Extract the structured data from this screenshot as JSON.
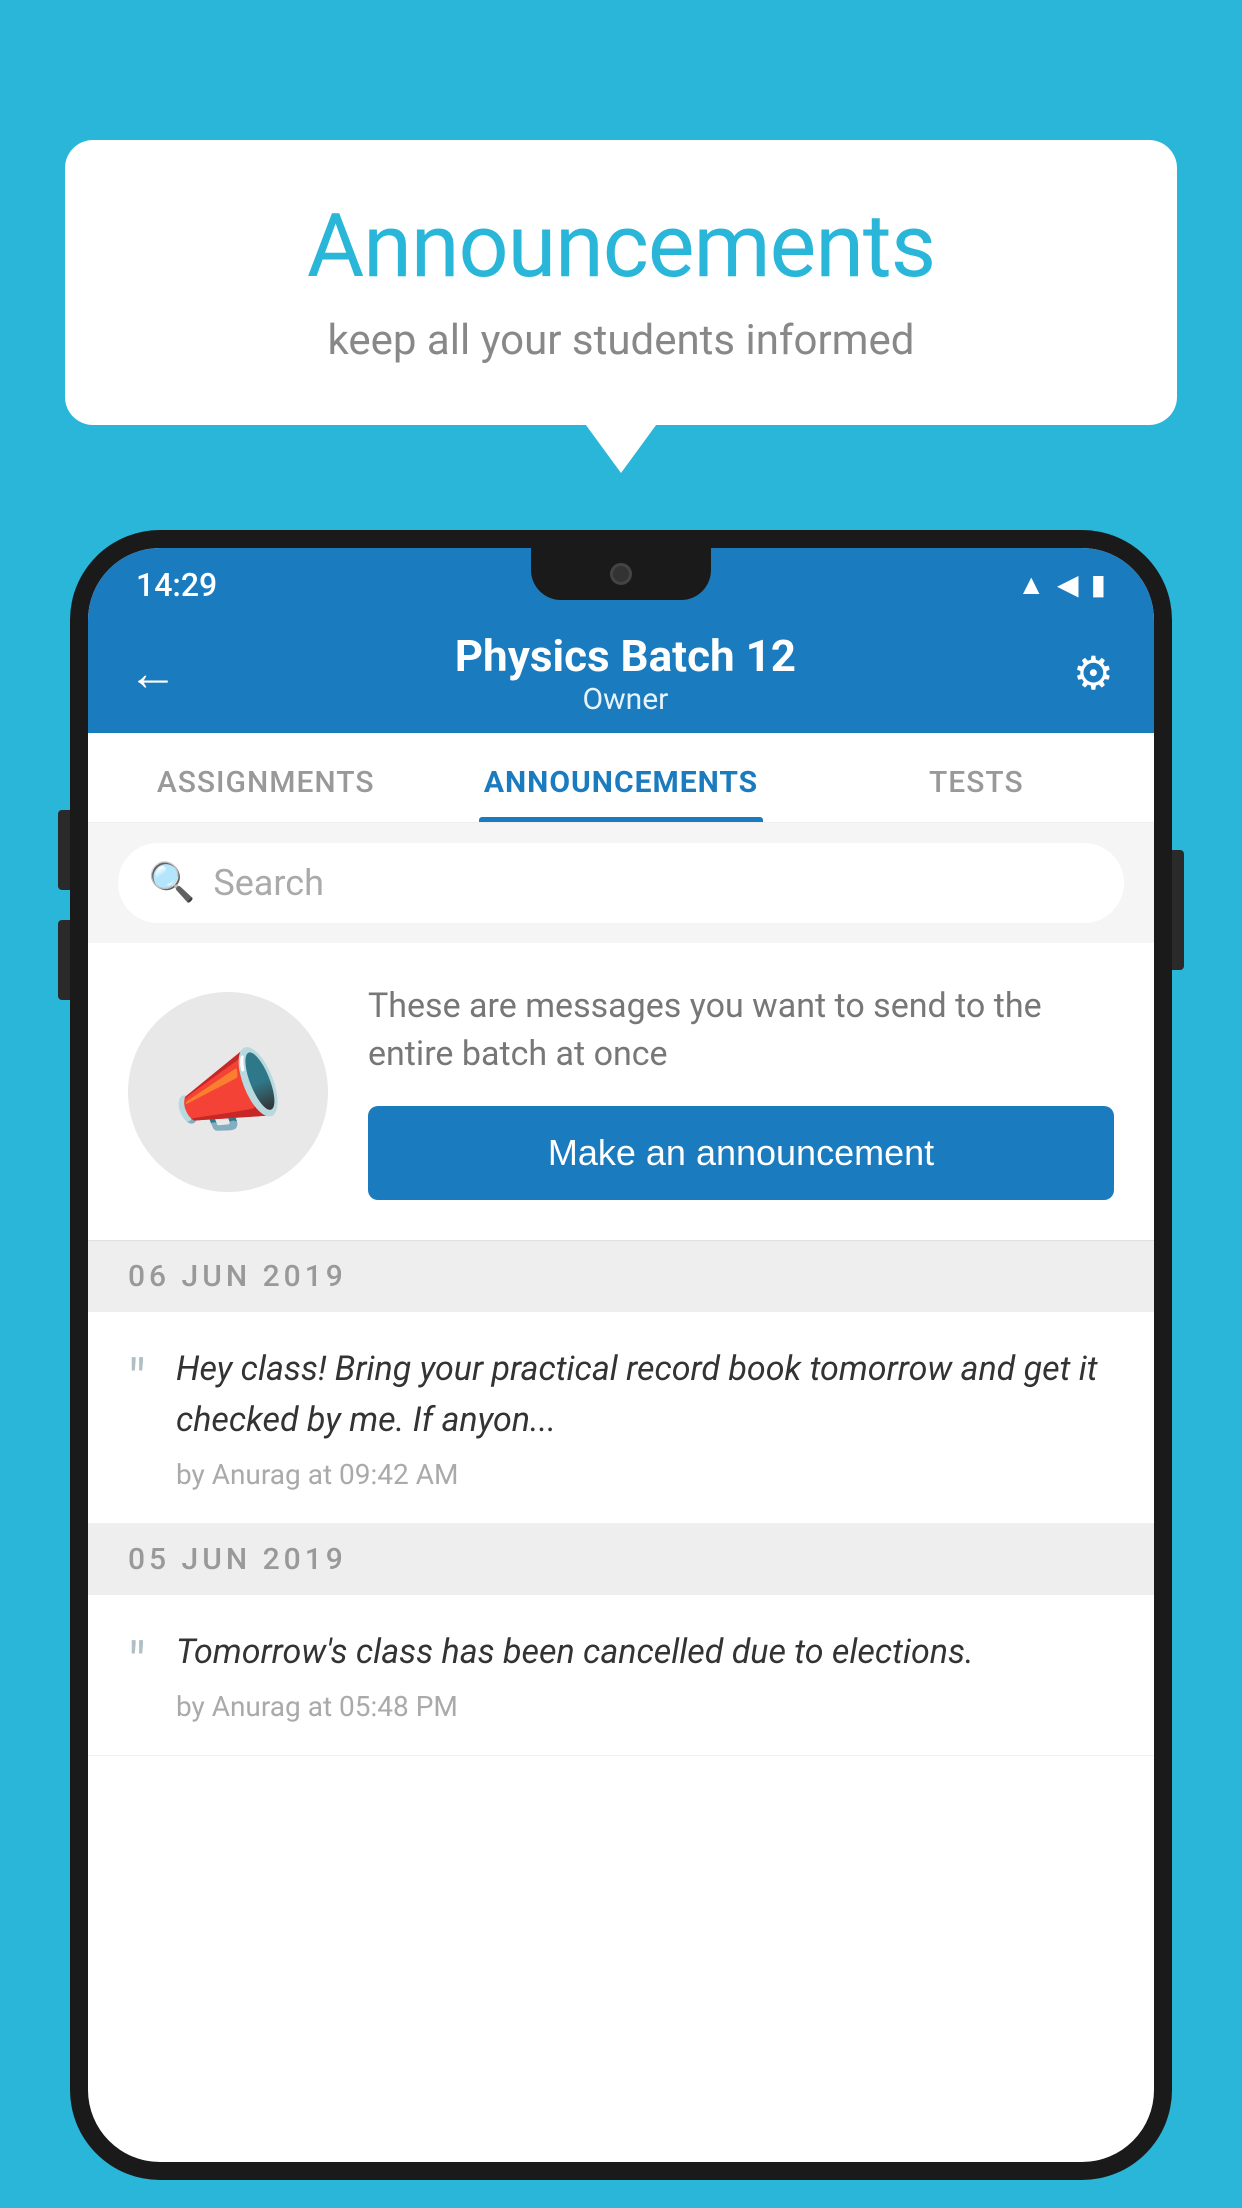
{
  "background_color": "#29b6d8",
  "speech_bubble": {
    "title": "Announcements",
    "subtitle": "keep all your students informed"
  },
  "status_bar": {
    "time": "14:29",
    "icons": [
      "wifi",
      "signal",
      "battery"
    ]
  },
  "app_bar": {
    "title": "Physics Batch 12",
    "subtitle": "Owner",
    "back_label": "←",
    "settings_label": "⚙"
  },
  "tabs": [
    {
      "label": "ASSIGNMENTS",
      "active": false
    },
    {
      "label": "ANNOUNCEMENTS",
      "active": true
    },
    {
      "label": "TESTS",
      "active": false
    }
  ],
  "search": {
    "placeholder": "Search"
  },
  "empty_state": {
    "description": "These are messages you want to send to the entire batch at once",
    "button_label": "Make an announcement"
  },
  "announcements": [
    {
      "date": "06  JUN  2019",
      "text": "Hey class! Bring your practical record book tomorrow and get it checked by me. If anyon...",
      "meta": "by Anurag at 09:42 AM"
    },
    {
      "date": "05  JUN  2019",
      "text": "Tomorrow's class has been cancelled due to elections.",
      "meta": "by Anurag at 05:48 PM"
    }
  ]
}
